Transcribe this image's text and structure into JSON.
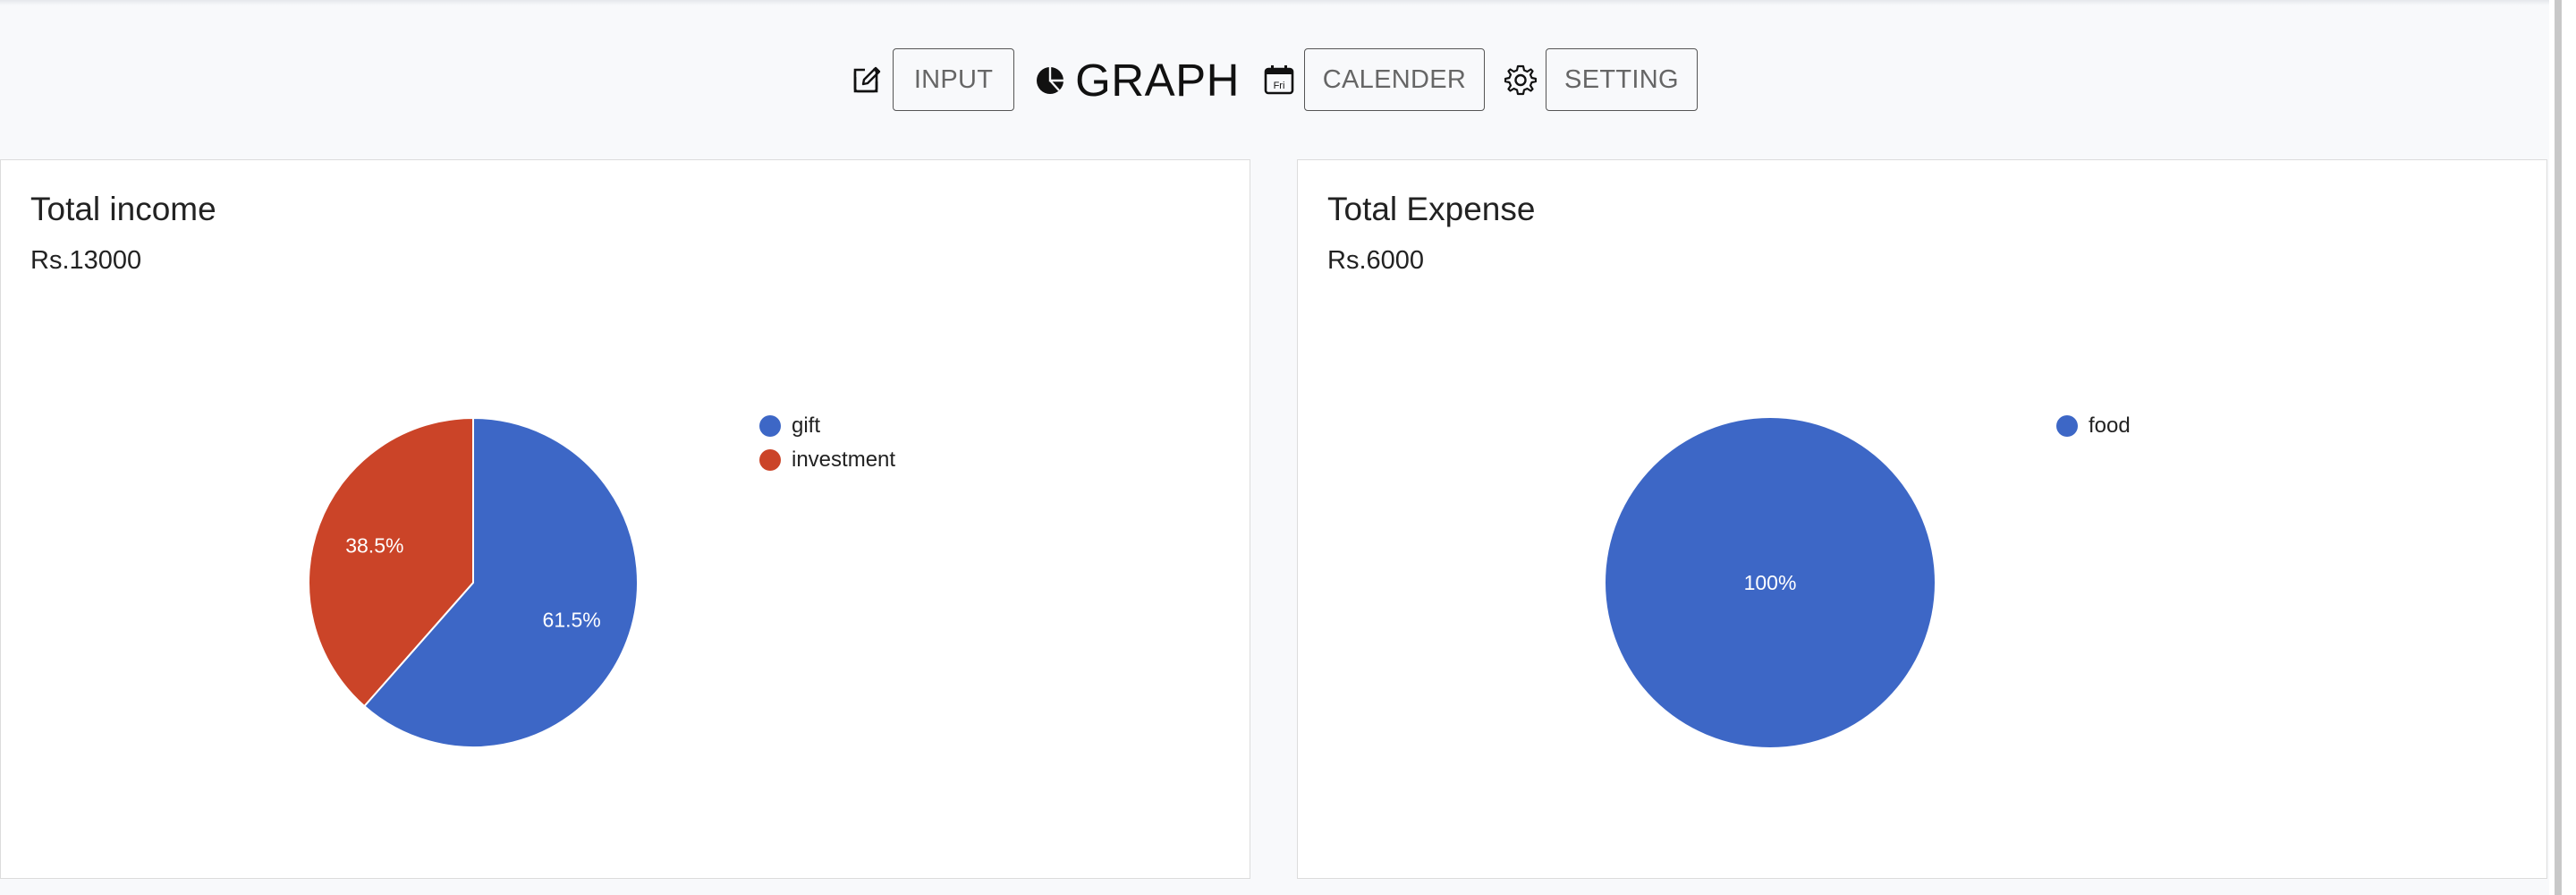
{
  "nav": {
    "input_label": "INPUT",
    "graph_label": "GRAPH",
    "calender_label": "CALENDER",
    "calendar_icon_text": "Fri",
    "setting_label": "SETTING",
    "icons": [
      "edit-icon",
      "pie-chart-icon",
      "calendar-icon",
      "gear-icon"
    ]
  },
  "income_card": {
    "title": "Total income",
    "amount": "Rs.13000"
  },
  "expense_card": {
    "title": "Total Expense",
    "amount": "Rs.6000"
  },
  "chart_data": [
    {
      "type": "pie",
      "categories": [
        "gift",
        "investment"
      ],
      "values": [
        61.5,
        38.5
      ],
      "labels": [
        "61.5%",
        "38.5%"
      ],
      "colors": [
        "#3d67c6",
        "#cb4428"
      ],
      "legend": "right"
    },
    {
      "type": "pie",
      "categories": [
        "food"
      ],
      "values": [
        100
      ],
      "labels": [
        "100%"
      ],
      "colors": [
        "#3d67c6"
      ],
      "legend": "right"
    }
  ]
}
